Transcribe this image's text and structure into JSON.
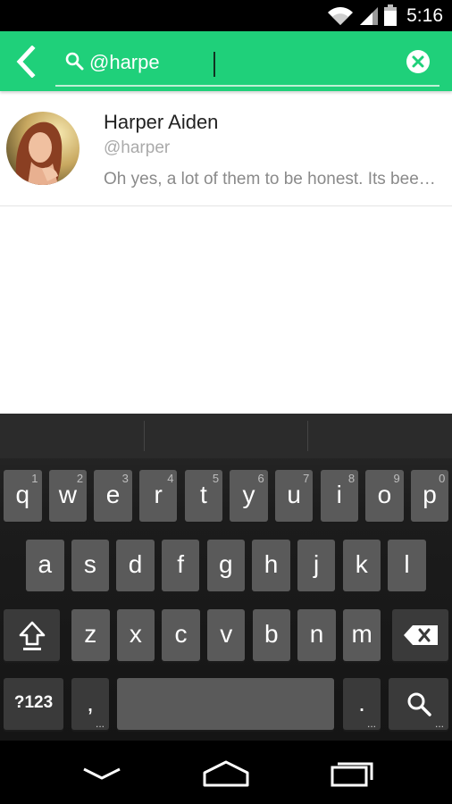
{
  "status_bar": {
    "time": "5:16",
    "icons": [
      "wifi-icon",
      "cell-signal-icon",
      "battery-icon"
    ]
  },
  "search": {
    "query": "@harpe",
    "back_icon": "chevron-left-icon",
    "search_icon": "search-icon",
    "clear_icon": "clear-icon"
  },
  "results": [
    {
      "name": "Harper Aiden",
      "handle": "@harper",
      "preview": "Oh yes, a lot of them to be honest. Its been quite the experience",
      "avatar": "avatar-photo"
    }
  ],
  "keyboard": {
    "rows": [
      [
        {
          "label": "q",
          "hint": "1"
        },
        {
          "label": "w",
          "hint": "2"
        },
        {
          "label": "e",
          "hint": "3"
        },
        {
          "label": "r",
          "hint": "4"
        },
        {
          "label": "t",
          "hint": "5"
        },
        {
          "label": "y",
          "hint": "6"
        },
        {
          "label": "u",
          "hint": "7"
        },
        {
          "label": "i",
          "hint": "8"
        },
        {
          "label": "o",
          "hint": "9"
        },
        {
          "label": "p",
          "hint": "0"
        }
      ],
      [
        {
          "label": "a"
        },
        {
          "label": "s"
        },
        {
          "label": "d"
        },
        {
          "label": "f"
        },
        {
          "label": "g"
        },
        {
          "label": "h"
        },
        {
          "label": "j"
        },
        {
          "label": "k"
        },
        {
          "label": "l"
        }
      ],
      [
        {
          "label": "z"
        },
        {
          "label": "x"
        },
        {
          "label": "c"
        },
        {
          "label": "v"
        },
        {
          "label": "b"
        },
        {
          "label": "n"
        },
        {
          "label": "m"
        }
      ]
    ],
    "symbols_label": "?123",
    "comma_label": ",",
    "period_label": ".",
    "dots_label": "...",
    "shift_icon": "shift-icon",
    "backspace_icon": "backspace-icon",
    "search_key_icon": "search-icon"
  },
  "nav_bar": {
    "icons": [
      "back-chevron-down-icon",
      "home-icon",
      "recents-icon"
    ]
  },
  "colors": {
    "accent": "#1fd07a",
    "status_bar": "#000000",
    "keyboard_key": "#5a5a5a"
  }
}
